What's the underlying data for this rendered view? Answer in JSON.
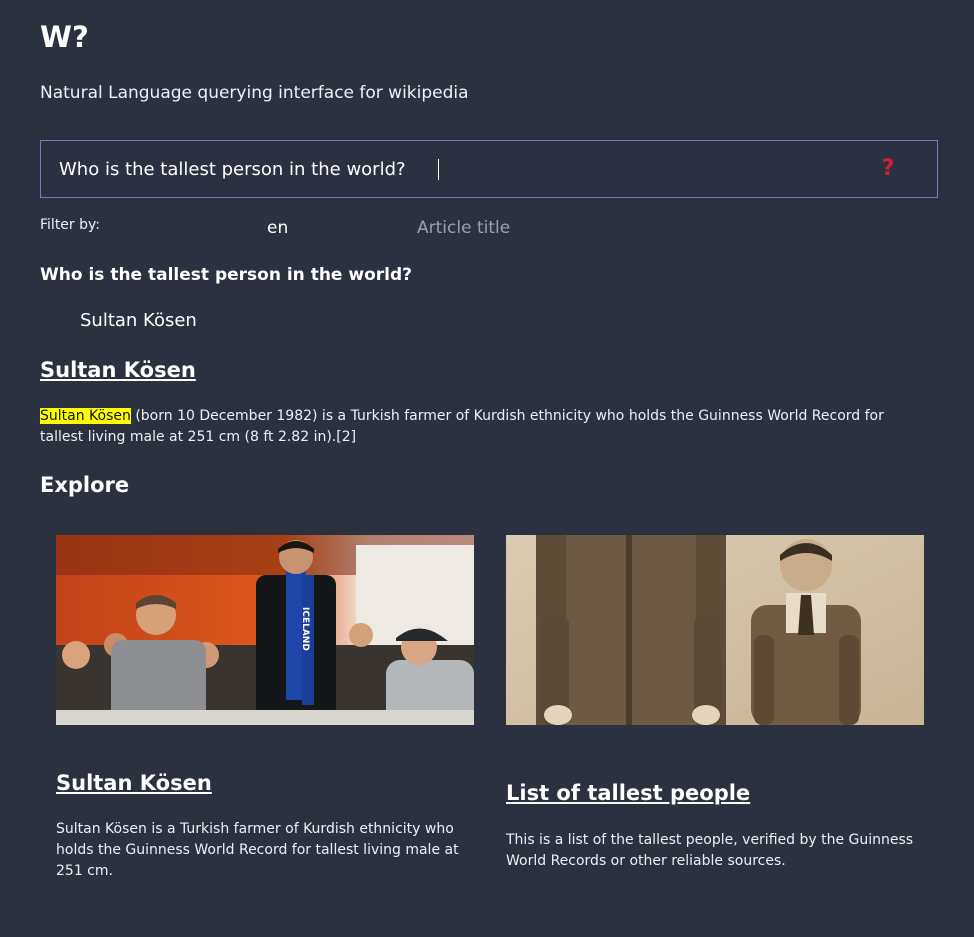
{
  "app": {
    "title": "W?",
    "subtitle": "Natural Language querying interface for wikipedia"
  },
  "search": {
    "value": "Who is the tallest person in the world?",
    "button_label": "?"
  },
  "filter": {
    "label": "Filter by:",
    "language_value": "en",
    "title_placeholder": "Article title"
  },
  "result": {
    "question": "Who is the tallest person in the world?",
    "answer": "Sultan Kösen",
    "article_title": "Sultan Kösen",
    "snippet_highlight": "Sultan Kösen",
    "snippet_rest": " (born 10 December 1982) is a Turkish farmer of Kurdish ethnicity who holds the Guinness World Record for tallest living male at 251 cm (8 ft 2.82 in).[2]"
  },
  "explore": {
    "heading": "Explore",
    "cards": [
      {
        "title": "Sultan Kösen",
        "description": "Sultan Kösen is a Turkish farmer of Kurdish ethnicity who holds the Guinness World Record for tallest living male at 251 cm.",
        "scarf_text": "ICELAND"
      },
      {
        "title": "List of tallest people",
        "description": "This is a list of the tallest people, verified by the Guinness World Records or other reliable sources."
      }
    ]
  },
  "colors": {
    "background": "#2c3140",
    "search_border": "#6c86b8",
    "ask_icon": "#d1202f",
    "highlight": "#ffff00"
  },
  "icons": {
    "ask": "question-mark-icon"
  }
}
